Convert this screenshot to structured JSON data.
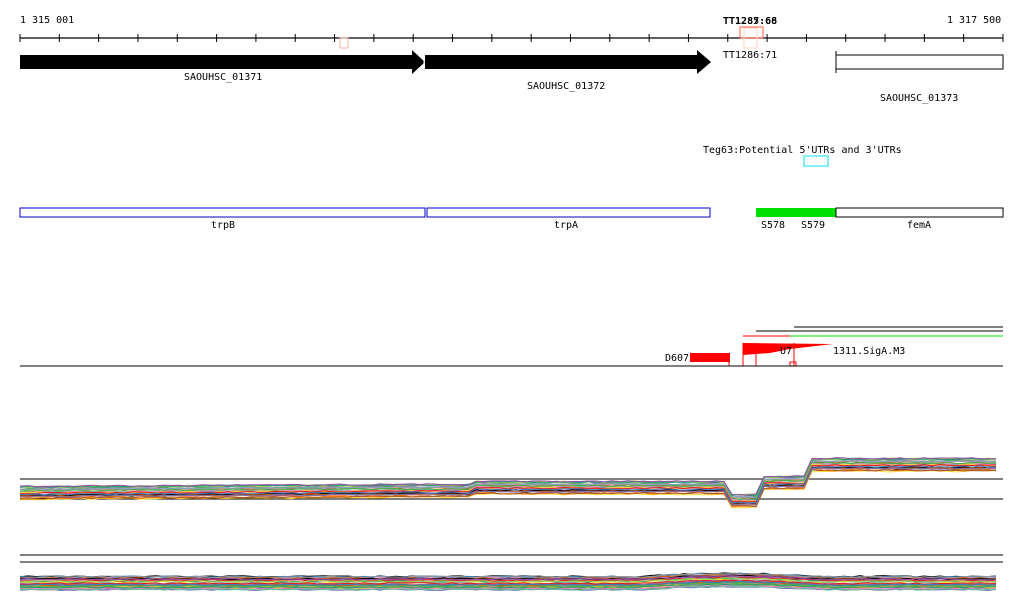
{
  "ruler": {
    "start_label": "1 315 001",
    "end_label": "1 317 500",
    "start": 1315001,
    "end": 1317500,
    "tick_step": 100
  },
  "terminators": [
    {
      "label": "TT1287:68"
    },
    {
      "label": "TT1285:66"
    },
    {
      "label": "TT1286:71"
    }
  ],
  "genes": [
    {
      "label": "SAOUHSC_01371",
      "strand": "+"
    },
    {
      "label": "SAOUHSC_01372",
      "strand": "+"
    },
    {
      "label": "SAOUHSC_01373",
      "strand": "+"
    }
  ],
  "utr_track": {
    "label": "Teg63:Potential 5'UTRs and 3'UTRs"
  },
  "annotation_genes": [
    {
      "label": "trpB"
    },
    {
      "label": "trpA"
    },
    {
      "label": "S578"
    },
    {
      "label": "S579"
    },
    {
      "label": "femA"
    }
  ],
  "features": [
    {
      "label": "D607"
    },
    {
      "label": "U7"
    },
    {
      "label": "1311.SigA.M3"
    }
  ],
  "colors": {
    "gene_outline": "#0000cc",
    "srna": "#00e000",
    "feature": "#ff0000",
    "utr": "#00e5ee",
    "terminator": "#ff6040"
  }
}
